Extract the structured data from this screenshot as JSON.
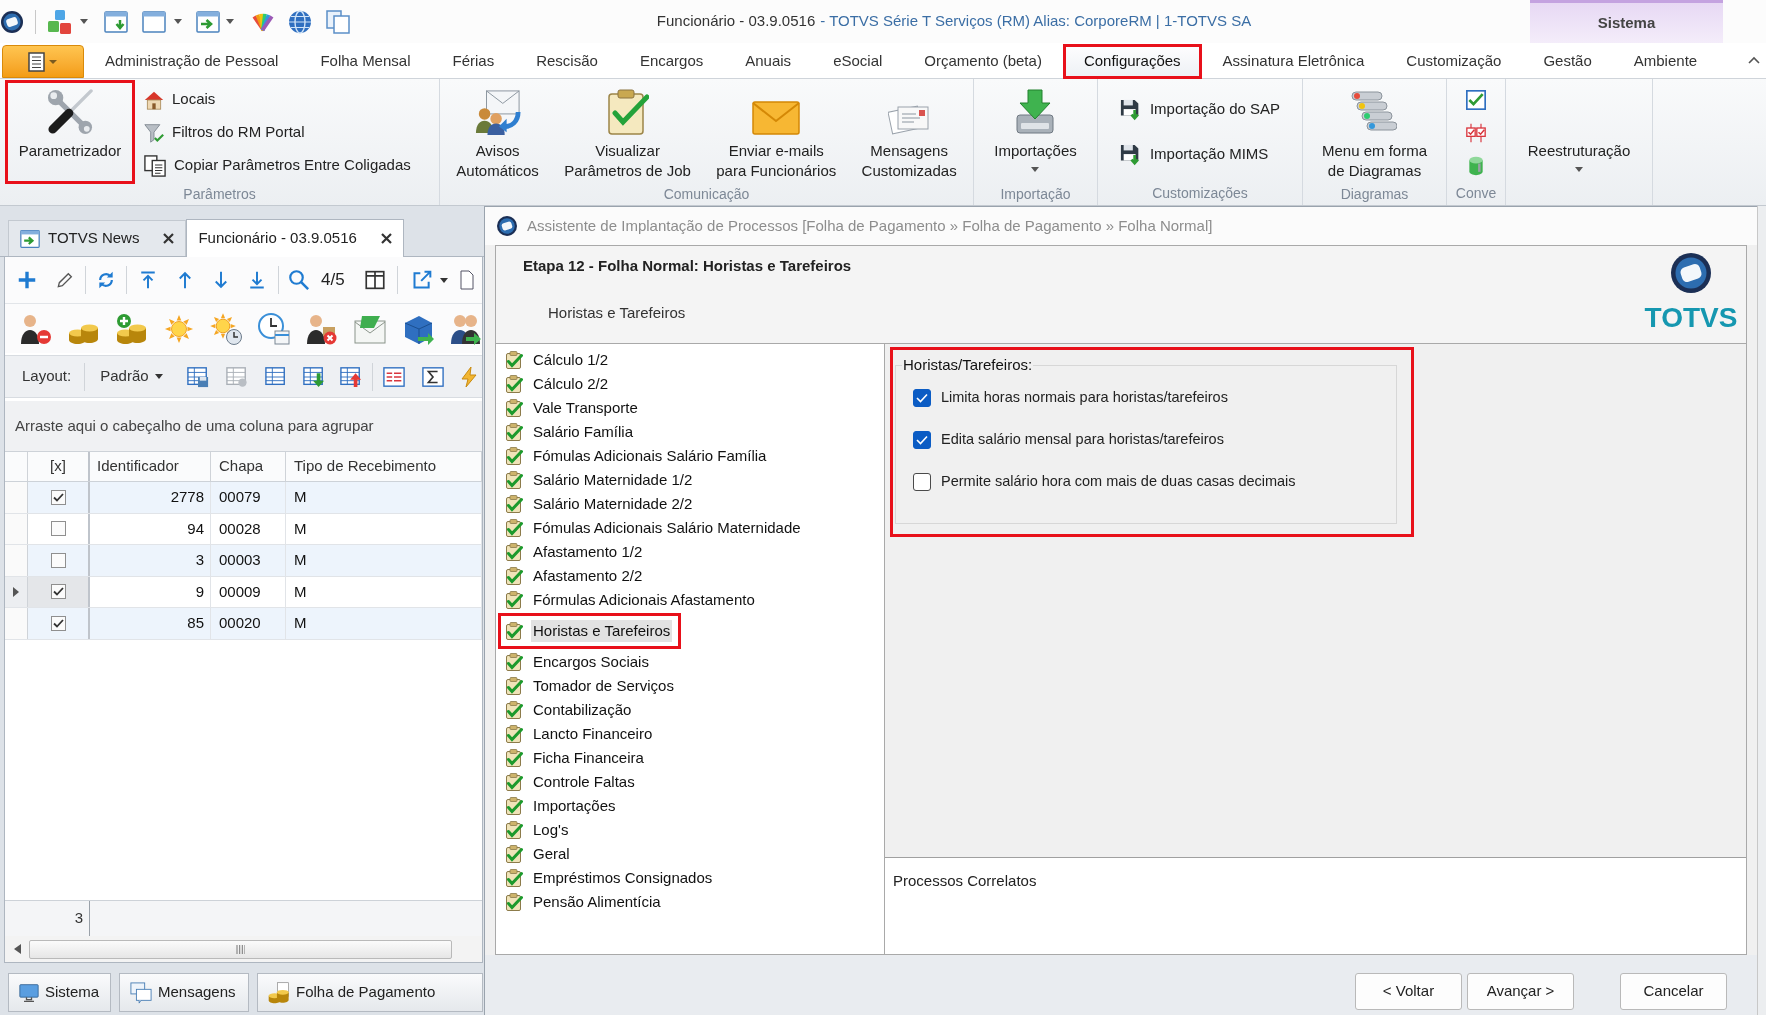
{
  "title_bar": {
    "title": "Funcionário - 03.9.0516",
    "app_info": "- TOTVS Série T Serviços (RM) Alias: CorporeRM | 1-TOTVS SA",
    "context_group": "Sistema"
  },
  "ribbon": {
    "tabs": [
      {
        "label": "Administração de Pessoal",
        "selected": false,
        "highlighted": false
      },
      {
        "label": "Folha Mensal",
        "selected": false,
        "highlighted": false
      },
      {
        "label": "Férias",
        "selected": false,
        "highlighted": false
      },
      {
        "label": "Rescisão",
        "selected": false,
        "highlighted": false
      },
      {
        "label": "Encargos",
        "selected": false,
        "highlighted": false
      },
      {
        "label": "Anuais",
        "selected": false,
        "highlighted": false
      },
      {
        "label": "eSocial",
        "selected": false,
        "highlighted": false
      },
      {
        "label": "Orçamento (beta)",
        "selected": false,
        "highlighted": false
      },
      {
        "label": "Configurações",
        "selected": true,
        "highlighted": true
      },
      {
        "label": "Assinatura Eletrônica",
        "selected": false,
        "highlighted": false
      },
      {
        "label": "Customização",
        "selected": false,
        "highlighted": false
      },
      {
        "label": "Gestão",
        "selected": false,
        "highlighted": false
      },
      {
        "label": "Ambiente",
        "selected": false,
        "highlighted": false
      }
    ],
    "groups": [
      {
        "label": "Parâmetros",
        "items": [
          {
            "kind": "large",
            "lines": [
              "Parametrizador"
            ],
            "highlighted": true
          },
          {
            "kind": "small",
            "label": "Locais",
            "highlighted": false
          },
          {
            "kind": "small",
            "label": "Filtros do RM Portal",
            "highlighted": false
          },
          {
            "kind": "small",
            "label": "Copiar Parâmetros Entre Coligadas",
            "highlighted": false
          }
        ]
      },
      {
        "label": "Comunicação",
        "items": [
          {
            "kind": "large",
            "lines": [
              "Avisos",
              "Automáticos"
            ],
            "highlighted": false
          },
          {
            "kind": "large",
            "lines": [
              "Visualizar",
              "Parâmetros de Job"
            ],
            "highlighted": false
          },
          {
            "kind": "large",
            "lines": [
              "Enviar e-mails",
              "para Funcionários"
            ],
            "highlighted": false
          },
          {
            "kind": "large",
            "lines": [
              "Mensagens",
              "Customizadas"
            ],
            "highlighted": false
          }
        ]
      },
      {
        "label": "Importação",
        "items": [
          {
            "kind": "dropdown",
            "lines": [
              "Importações"
            ],
            "highlighted": false
          }
        ]
      },
      {
        "label": "Customizações",
        "items": [
          {
            "kind": "small",
            "label": "Importação do SAP",
            "highlighted": false
          },
          {
            "kind": "small",
            "label": "Importação MIMS",
            "highlighted": false
          }
        ]
      },
      {
        "label": "Diagramas",
        "items": [
          {
            "kind": "large",
            "lines": [
              "Menu em forma",
              "de Diagramas"
            ],
            "highlighted": false
          }
        ]
      },
      {
        "label": "Conve",
        "items": [
          {
            "kind": "icon",
            "highlighted": false
          },
          {
            "kind": "icon",
            "highlighted": false
          },
          {
            "kind": "icon",
            "highlighted": false
          }
        ]
      },
      {
        "items": [
          {
            "kind": "dropdown",
            "lines": [
              "Reestruturação"
            ],
            "highlighted": false
          }
        ]
      }
    ]
  },
  "workspace": {
    "tabs": [
      {
        "label": "TOTVS News",
        "selected": false
      },
      {
        "label": "Funcionário - 03.9.0516",
        "selected": true
      }
    ],
    "record_position": "4/5",
    "layout_label": "Layout:",
    "layout_value": "Padrão",
    "group_hint": "Arraste aqui o cabeçalho de uma coluna para agrupar",
    "grid": {
      "check_column": "[x]",
      "columns": [
        "Identificador",
        "Chapa",
        "Tipo de Recebimento"
      ],
      "rows": [
        {
          "checked": true,
          "current": false,
          "cells": [
            "2778",
            "00079",
            "M"
          ]
        },
        {
          "checked": false,
          "current": false,
          "cells": [
            "94",
            "00028",
            "M"
          ]
        },
        {
          "checked": false,
          "current": false,
          "cells": [
            "3",
            "00003",
            "M"
          ]
        },
        {
          "checked": true,
          "current": true,
          "cells": [
            "9",
            "00009",
            "M"
          ]
        },
        {
          "checked": true,
          "current": false,
          "cells": [
            "85",
            "00020",
            "M"
          ]
        }
      ],
      "footer": "3"
    },
    "bottom_tabs": [
      "Sistema",
      "Mensagens",
      "Folha de Pagamento"
    ]
  },
  "dialog": {
    "title": "Assistente de Implantação de Processos [Folha de Pagamento » Folha de Pagamento » Folha Normal]",
    "step_title": "Etapa 12 - Folha Normal: Horistas e Tarefeiros",
    "step_subtitle": "Horistas e Tarefeiros",
    "logo": "TOTVS",
    "steps": [
      {
        "label": "Cálculo 1/2",
        "done": true,
        "selected": false,
        "highlighted": false
      },
      {
        "label": "Cálculo 2/2",
        "done": true,
        "selected": false,
        "highlighted": false
      },
      {
        "label": "Vale Transporte",
        "done": true,
        "selected": false,
        "highlighted": false
      },
      {
        "label": "Salário Família",
        "done": true,
        "selected": false,
        "highlighted": false
      },
      {
        "label": "Fómulas Adicionais Salário Família",
        "done": true,
        "selected": false,
        "highlighted": false
      },
      {
        "label": "Salário Maternidade 1/2",
        "done": true,
        "selected": false,
        "highlighted": false
      },
      {
        "label": "Salário Maternidade 2/2",
        "done": true,
        "selected": false,
        "highlighted": false
      },
      {
        "label": "Fómulas Adicionais Salário Maternidade",
        "done": true,
        "selected": false,
        "highlighted": false
      },
      {
        "label": "Afastamento 1/2",
        "done": true,
        "selected": false,
        "highlighted": false
      },
      {
        "label": "Afastamento 2/2",
        "done": true,
        "selected": false,
        "highlighted": false
      },
      {
        "label": "Fórmulas Adicionais Afastamento",
        "done": true,
        "selected": false,
        "highlighted": false
      },
      {
        "label": "Horistas e Tarefeiros",
        "done": true,
        "selected": true,
        "highlighted": true
      },
      {
        "label": "Encargos Sociais",
        "done": true,
        "selected": false,
        "highlighted": false
      },
      {
        "label": "Tomador de Serviços",
        "done": true,
        "selected": false,
        "highlighted": false
      },
      {
        "label": "Contabilização",
        "done": true,
        "selected": false,
        "highlighted": false
      },
      {
        "label": "Lancto Financeiro",
        "done": true,
        "selected": false,
        "highlighted": false
      },
      {
        "label": "Ficha Financeira",
        "done": true,
        "selected": false,
        "highlighted": false
      },
      {
        "label": "Controle Faltas",
        "done": true,
        "selected": false,
        "highlighted": false
      },
      {
        "label": "Importações",
        "done": true,
        "selected": false,
        "highlighted": false
      },
      {
        "label": "Log's",
        "done": true,
        "selected": false,
        "highlighted": false
      },
      {
        "label": "Geral",
        "done": true,
        "selected": false,
        "highlighted": false
      },
      {
        "label": "Empréstimos Consignados",
        "done": true,
        "selected": false,
        "highlighted": false
      },
      {
        "label": "Pensão Alimentícia",
        "done": true,
        "selected": false,
        "highlighted": false
      }
    ],
    "options_group": {
      "title": "Horistas/Tarefeiros:",
      "highlighted": true,
      "options": [
        {
          "label": "Limita horas normais para horistas/tarefeiros",
          "checked": true
        },
        {
          "label": "Edita salário mensal para horistas/tarefeiros",
          "checked": true
        },
        {
          "label": "Permite salário hora com mais de duas casas decimais",
          "checked": false
        }
      ]
    },
    "related_title": "Processos Correlatos",
    "buttons": [
      "< Voltar",
      "Avançar >",
      "Cancelar"
    ]
  }
}
